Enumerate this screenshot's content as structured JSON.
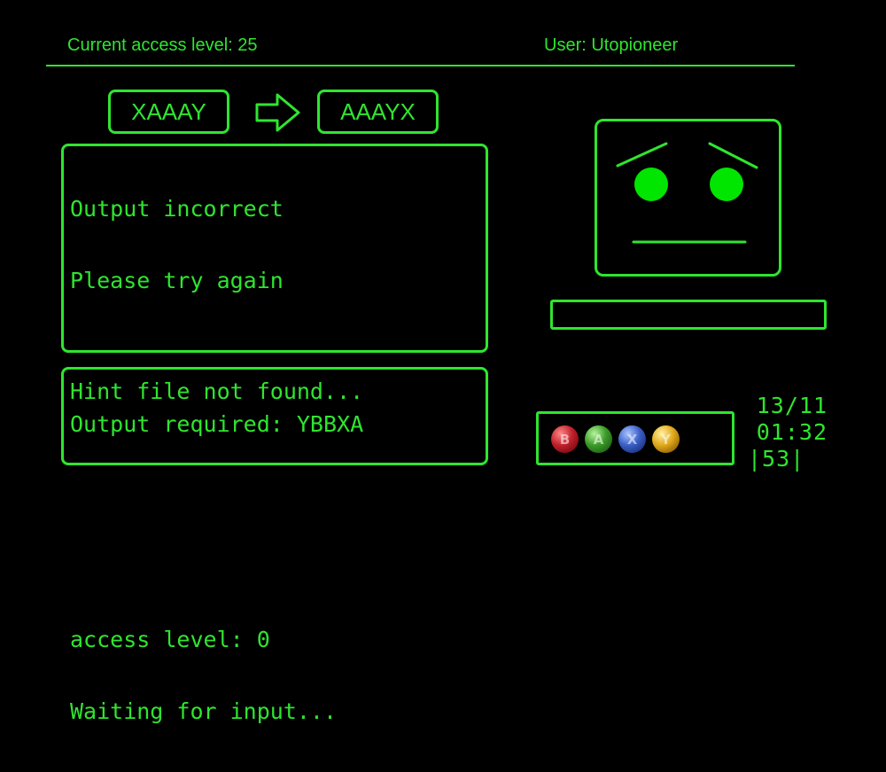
{
  "header": {
    "access_level": "Current access level: 25",
    "user": "User: Utopioneer"
  },
  "transform": {
    "input": "XAAAY",
    "output": "AAAYX",
    "arrow_icon": "right-arrow-icon"
  },
  "terminal": {
    "lines": [
      "Output incorrect",
      "Please try again",
      "",
      "Output required: YBBXA",
      "",
      "",
      "access level: 0",
      "Waiting for input..."
    ]
  },
  "hint": {
    "text": "Hint file not found..."
  },
  "face": {
    "mood": "worried"
  },
  "buttons": [
    {
      "label": "B",
      "color": "#c0202a",
      "icon": "b-button-icon"
    },
    {
      "label": "A",
      "color": "#3a9a28",
      "icon": "a-button-icon"
    },
    {
      "label": "X",
      "color": "#3a5fc8",
      "icon": "x-button-icon"
    },
    {
      "label": "Y",
      "color": "#e0a81a",
      "icon": "y-button-icon"
    }
  ],
  "clock": {
    "date": "13/11",
    "time": "01:32",
    "counter": "|53|"
  },
  "colors": {
    "accent": "#2fe52f",
    "background": "#000000"
  }
}
